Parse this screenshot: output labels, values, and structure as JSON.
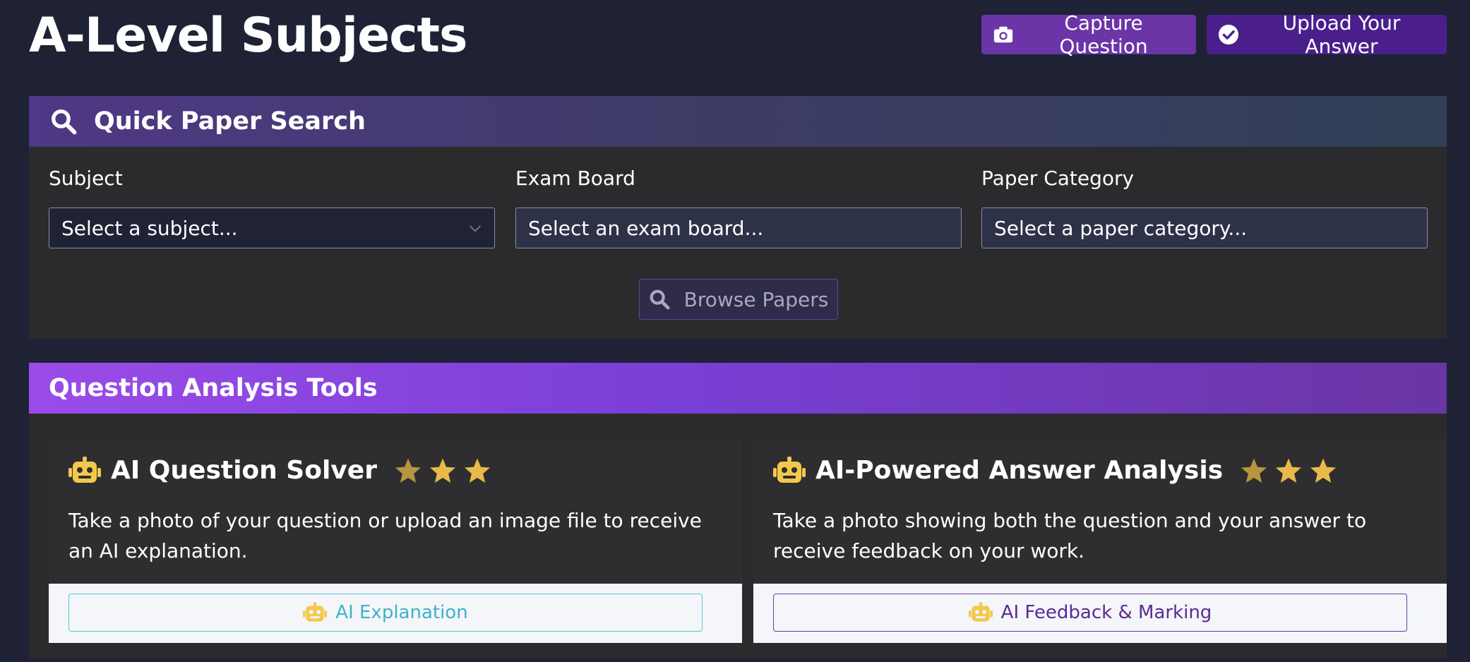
{
  "page": {
    "title": "A-Level Subjects"
  },
  "header_actions": {
    "capture_label": "Capture Question",
    "capture_icon": "camera-icon",
    "upload_label": "Upload Your Answer",
    "upload_icon": "check-circle-icon"
  },
  "search_card": {
    "title": "Quick Paper Search",
    "icon": "search-icon",
    "fields": [
      {
        "label": "Subject",
        "value": "Select a subject..."
      },
      {
        "label": "Exam Board",
        "value": "Select an exam board..."
      },
      {
        "label": "Paper Category",
        "value": "Select a paper category..."
      }
    ],
    "browse_label": "Browse Papers"
  },
  "tools_card": {
    "title": "Question Analysis Tools",
    "tools": [
      {
        "title": "AI Question Solver",
        "icon": "robot-icon",
        "stars": 3,
        "description": "Take a photo of your question or upload an image file to receive an AI explanation.",
        "button_label": "AI Explanation"
      },
      {
        "title": "AI-Powered Answer Analysis",
        "icon": "robot-icon",
        "stars": 3,
        "description": "Take a photo showing both the question and your answer to receive feedback on your work.",
        "button_label": "AI Feedback & Marking"
      }
    ]
  },
  "colors": {
    "background": "#1e2234",
    "card": "#2b2b2e",
    "capture_button": "#6b35a8",
    "upload_button": "#4a1f8c",
    "star": "#e9b949",
    "robot": "#f2c94c",
    "explain_accent": "#3fb2c9",
    "feedback_accent": "#5c2a94"
  }
}
